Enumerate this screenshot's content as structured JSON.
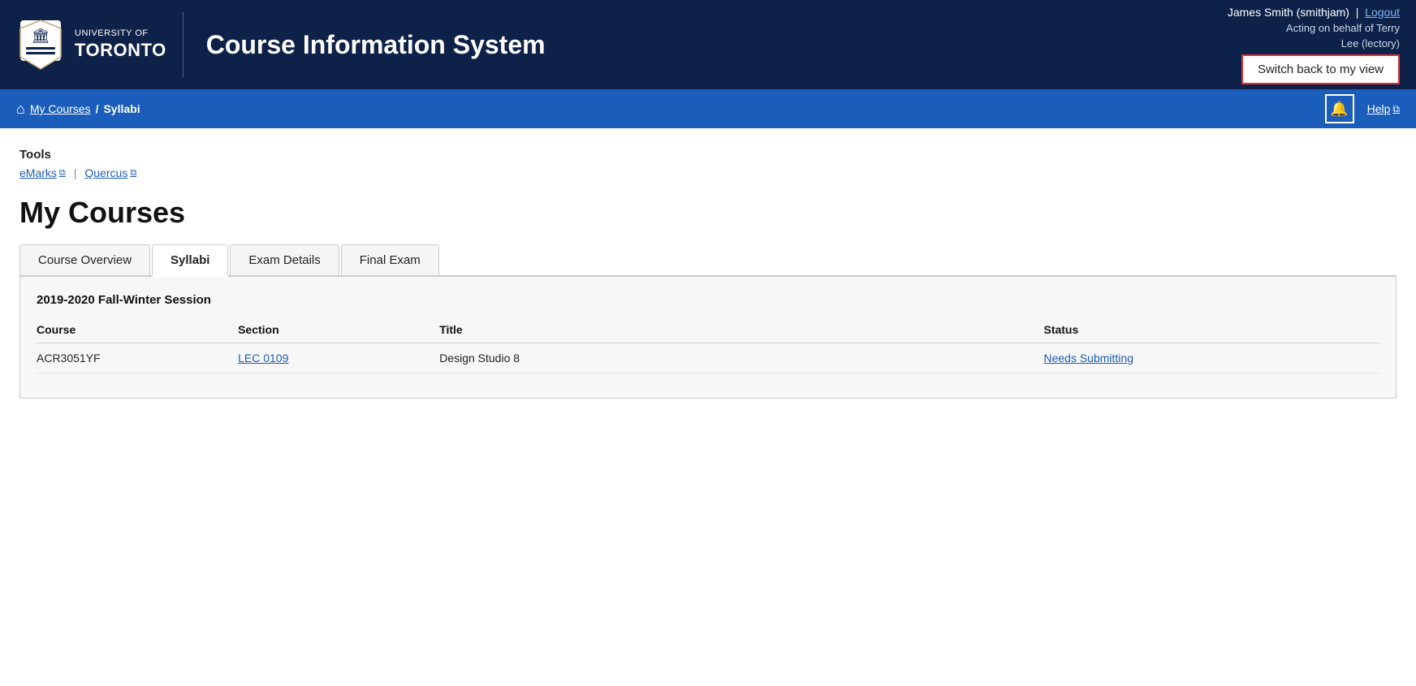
{
  "header": {
    "logo_line1": "UNIVERSITY OF",
    "logo_line2": "TORONTO",
    "system_title": "Course Information System",
    "user_name": "James Smith (smithjam)",
    "logout_label": "Logout",
    "acting_label": "Acting on behalf of Terry",
    "acting_label2": "Lee (lectory)",
    "switch_back_label": "Switch back to my view"
  },
  "navbar": {
    "home_icon": "⌂",
    "breadcrumb_link": "My Courses",
    "breadcrumb_separator": "/",
    "breadcrumb_current": "Syllabi",
    "bell_icon": "🔔",
    "help_label": "Help",
    "external_icon": "⧉"
  },
  "tools": {
    "label": "Tools",
    "emarks_label": "eMarks",
    "quercus_label": "Quercus",
    "external_icon": "⧉"
  },
  "main": {
    "page_heading": "My Courses",
    "tabs": [
      {
        "id": "course-overview",
        "label": "Course Overview",
        "active": false
      },
      {
        "id": "syllabi",
        "label": "Syllabi",
        "active": true
      },
      {
        "id": "exam-details",
        "label": "Exam Details",
        "active": false
      },
      {
        "id": "final-exam",
        "label": "Final Exam",
        "active": false
      }
    ],
    "session_label": "2019-2020 Fall-Winter Session",
    "table": {
      "columns": [
        "Course",
        "Section",
        "Title",
        "Status"
      ],
      "rows": [
        {
          "course": "ACR3051YF",
          "section": "LEC 0109",
          "title": "Design Studio 8",
          "status": "Needs Submitting",
          "status_is_link": true
        }
      ]
    }
  }
}
